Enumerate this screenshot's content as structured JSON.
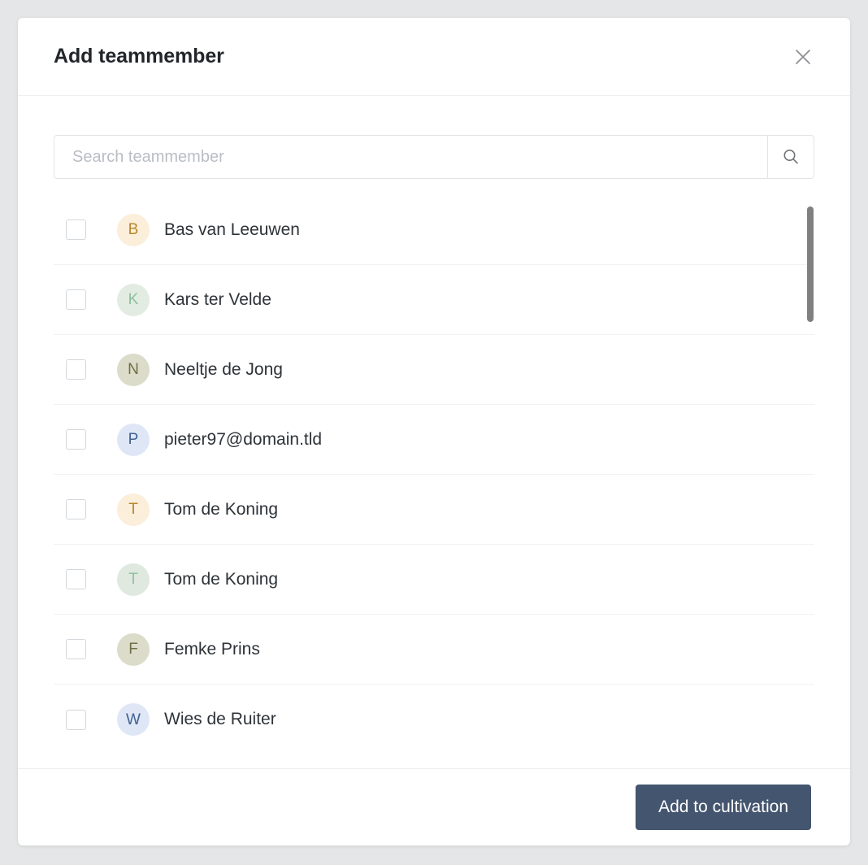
{
  "page": {
    "background_color": "#e5e6e7"
  },
  "modal": {
    "title": "Add teammember",
    "close_icon": "close-icon",
    "search": {
      "placeholder": "Search teammember",
      "value": "",
      "button_icon": "search-icon"
    },
    "list": {
      "items": [
        {
          "name": "Bas van Leeuwen",
          "initial": "B",
          "avatar_bg": "#fbeedb",
          "avatar_fg": "#b7872b",
          "checked": false
        },
        {
          "name": "Kars ter Velde",
          "initial": "K",
          "avatar_bg": "#e2ece3",
          "avatar_fg": "#8fbf9c",
          "checked": false
        },
        {
          "name": "Neeltje de Jong",
          "initial": "N",
          "avatar_bg": "#dbdcca",
          "avatar_fg": "#6f7045",
          "checked": false
        },
        {
          "name": "pieter97@domain.tld",
          "initial": "P",
          "avatar_bg": "#dfe7f6",
          "avatar_fg": "#41618f",
          "checked": false
        },
        {
          "name": "Tom de Koning",
          "initial": "T",
          "avatar_bg": "#fbeedb",
          "avatar_fg": "#b7872b",
          "checked": false
        },
        {
          "name": "Tom de Koning",
          "initial": "T",
          "avatar_bg": "#dfe9e0",
          "avatar_fg": "#93c0a0",
          "checked": false
        },
        {
          "name": "Femke Prins",
          "initial": "F",
          "avatar_bg": "#dbdcca",
          "avatar_fg": "#6f7045",
          "checked": false
        },
        {
          "name": "Wies de Ruiter",
          "initial": "W",
          "avatar_bg": "#dfe7f6",
          "avatar_fg": "#41618f",
          "checked": false
        }
      ]
    },
    "footer": {
      "primary_label": "Add to cultivation",
      "primary_color": "#44556f"
    }
  }
}
